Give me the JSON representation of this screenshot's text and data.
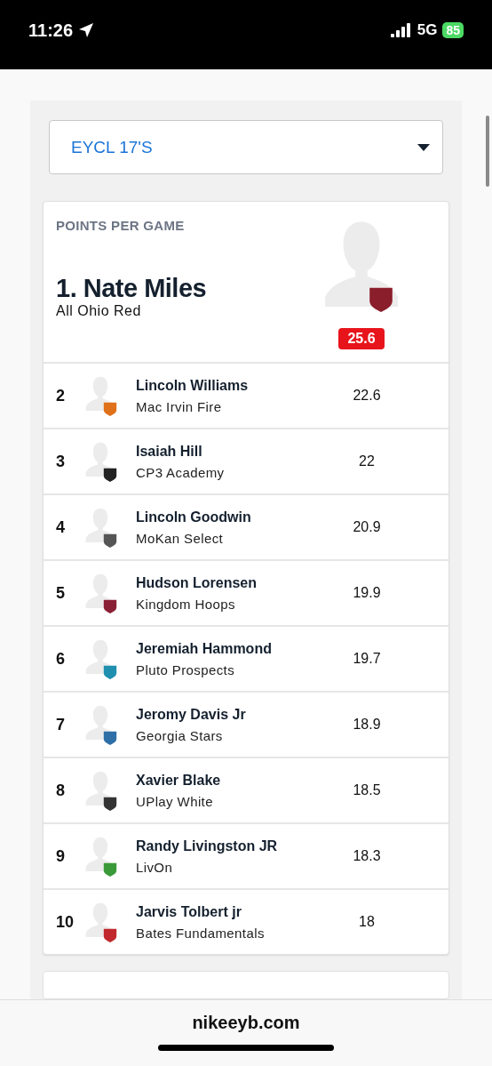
{
  "status_bar": {
    "time": "11:26",
    "network": "5G",
    "battery": "85"
  },
  "league_select": {
    "value": "EYCL 17'S"
  },
  "leaderboard": {
    "title": "POINTS PER GAME",
    "leader": {
      "rank_name": "1. Nate Miles",
      "team": "All Ohio Red",
      "value": "25.6",
      "color": "#8b1e2b"
    },
    "rows": [
      {
        "rank": "2",
        "name": "Lincoln Williams",
        "team": "Mac Irvin Fire",
        "value": "22.6",
        "color": "#e0701a"
      },
      {
        "rank": "3",
        "name": "Isaiah Hill",
        "team": "CP3 Academy",
        "value": "22",
        "color": "#222222"
      },
      {
        "rank": "4",
        "name": "Lincoln Goodwin",
        "team": "MoKan Select",
        "value": "20.9",
        "color": "#555555"
      },
      {
        "rank": "5",
        "name": "Hudson Lorensen",
        "team": "Kingdom Hoops",
        "value": "19.9",
        "color": "#8a2035"
      },
      {
        "rank": "6",
        "name": "Jeremiah Hammond",
        "team": "Pluto Prospects",
        "value": "19.7",
        "color": "#1f8fb0"
      },
      {
        "rank": "7",
        "name": "Jeromy Davis Jr",
        "team": "Georgia Stars",
        "value": "18.9",
        "color": "#2f6fa8"
      },
      {
        "rank": "8",
        "name": "Xavier Blake",
        "team": "UPlay White",
        "value": "18.5",
        "color": "#333333"
      },
      {
        "rank": "9",
        "name": "Randy Livingston JR",
        "team": "LivOn",
        "value": "18.3",
        "color": "#3a9a3a"
      },
      {
        "rank": "10",
        "name": "Jarvis Tolbert jr",
        "team": "Bates Fundamentals",
        "value": "18",
        "color": "#c0282d"
      }
    ]
  },
  "browser_bar": {
    "url": "nikeeyb.com"
  }
}
